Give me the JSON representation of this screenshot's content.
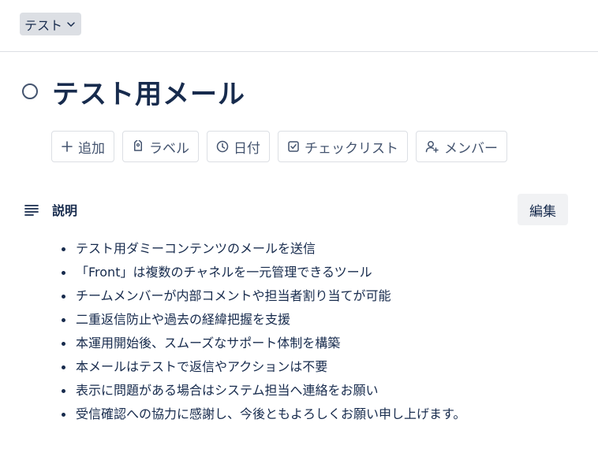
{
  "list_chip": {
    "label": "テスト"
  },
  "card": {
    "title": "テスト用メール"
  },
  "actions": [
    {
      "label": "追加",
      "icon": "plus-icon"
    },
    {
      "label": "ラベル",
      "icon": "tag-icon"
    },
    {
      "label": "日付",
      "icon": "clock-icon"
    },
    {
      "label": "チェックリスト",
      "icon": "checkbox-icon"
    },
    {
      "label": "メンバー",
      "icon": "add-member-icon"
    }
  ],
  "description": {
    "title": "説明",
    "edit_label": "編集",
    "items": [
      "テスト用ダミーコンテンツのメールを送信",
      "「Front」は複数のチャネルを一元管理できるツール",
      "チームメンバーが内部コメントや担当者割り当てが可能",
      "二重返信防止や過去の経緯把握を支援",
      "本運用開始後、スムーズなサポート体制を構築",
      "本メールはテストで返信やアクションは不要",
      "表示に問題がある場合はシステム担当へ連絡をお願い",
      "受信確認への協力に感謝し、今後ともよろしくお願い申し上げます。"
    ]
  }
}
